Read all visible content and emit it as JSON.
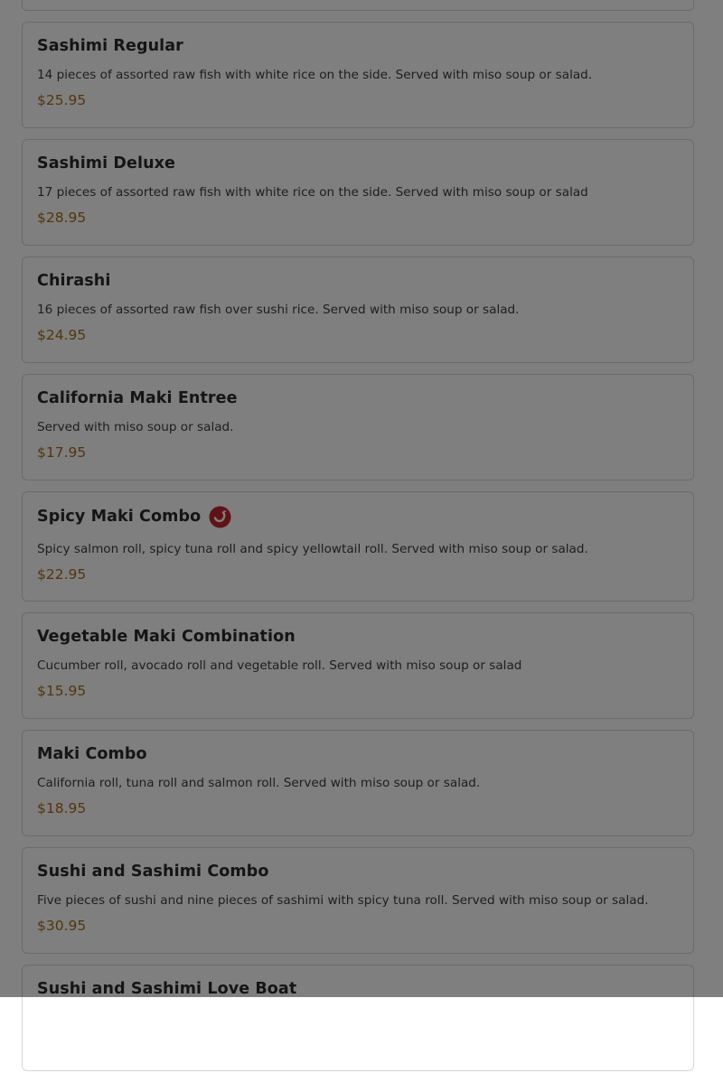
{
  "menu_items": [
    {
      "name": "Sashimi Regular",
      "description": "14 pieces of assorted raw fish with white rice on the side. Served with miso soup or salad.",
      "price": "$25.95",
      "spicy": false
    },
    {
      "name": "Sashimi Deluxe",
      "description": "17 pieces of assorted raw fish with white rice on the side. Served with miso soup or salad",
      "price": "$28.95",
      "spicy": false
    },
    {
      "name": "Chirashi",
      "description": "16 pieces of assorted raw fish over sushi rice. Served with miso soup or salad.",
      "price": "$24.95",
      "spicy": false
    },
    {
      "name": "California Maki Entree",
      "description": "Served with miso soup or salad.",
      "price": "$17.95",
      "spicy": false
    },
    {
      "name": "Spicy Maki Combo",
      "description": "Spicy salmon roll, spicy tuna roll and spicy yellowtail roll. Served with miso soup or salad.",
      "price": "$22.95",
      "spicy": true
    },
    {
      "name": "Vegetable Maki Combination",
      "description": "Cucumber roll, avocado roll and vegetable roll. Served with miso soup or salad",
      "price": "$15.95",
      "spicy": false
    },
    {
      "name": "Maki Combo",
      "description": "California roll, tuna roll and salmon roll. Served with miso soup or salad.",
      "price": "$18.95",
      "spicy": false
    },
    {
      "name": "Sushi and Sashimi Combo",
      "description": "Five pieces of sushi and nine pieces of sashimi with spicy tuna roll. Served with miso soup or salad.",
      "price": "$30.95",
      "spicy": false
    },
    {
      "name": "Sushi and Sashimi Love Boat",
      "description": "",
      "price": "",
      "spicy": false
    }
  ],
  "colors": {
    "price": "#a86a18",
    "title": "#2a2a2a",
    "card_border": "#d6d6d6",
    "spicy_icon": "#c0262c",
    "overlay": "rgba(0,0,0,0.5)"
  },
  "icons": {
    "spicy": "chili-pepper-icon"
  }
}
